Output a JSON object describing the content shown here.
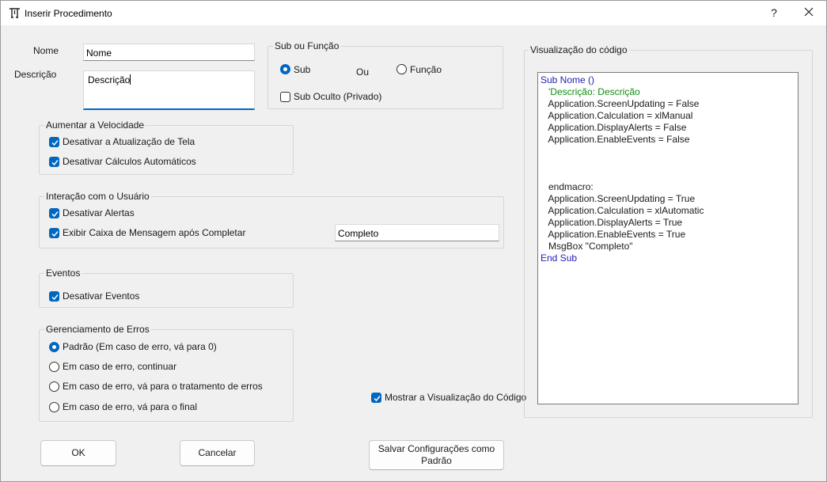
{
  "window": {
    "title": "Inserir Procedimento",
    "help_label": "?"
  },
  "form": {
    "name_label": "Nome",
    "name_value": "Nome",
    "description_label": "Descrição",
    "description_value": "Descrição"
  },
  "sub_function": {
    "legend": "Sub ou Função",
    "sub_label": "Sub",
    "or_label": "Ou",
    "function_label": "Função",
    "selected": "Sub",
    "hidden_label": "Sub Oculto (Privado)",
    "hidden_checked": false
  },
  "speed": {
    "legend": "Aumentar a Velocidade",
    "items": [
      {
        "label": "Desativar a Atualização de Tela",
        "checked": true
      },
      {
        "label": "Desativar Cálculos Automáticos",
        "checked": true
      }
    ]
  },
  "user_interaction": {
    "legend": "Interação com o Usuário",
    "items": [
      {
        "label": "Desativar Alertas",
        "checked": true
      },
      {
        "label": "Exibir Caixa de Mensagem após Completar",
        "checked": true
      }
    ],
    "message_value": "Completo"
  },
  "events": {
    "legend": "Eventos",
    "items": [
      {
        "label": "Desativar Eventos",
        "checked": true
      }
    ]
  },
  "error_handling": {
    "legend": "Gerenciamento de Erros",
    "options": [
      {
        "label": "Padrão (Em caso de erro, vá para 0)",
        "selected": true
      },
      {
        "label": "Em caso de erro, continuar",
        "selected": false
      },
      {
        "label": "Em caso de erro, vá para o tratamento de erros",
        "selected": false
      },
      {
        "label": "Em caso de erro, vá para o final",
        "selected": false
      }
    ]
  },
  "preview": {
    "legend": "Visualização do código",
    "show_label": "Mostrar a Visualização do Código",
    "show_checked": true,
    "lines": [
      {
        "text": "Sub Nome ()",
        "kind": "keyword"
      },
      {
        "text": "   'Descrição: Descrição",
        "kind": "comment"
      },
      {
        "text": "   Application.ScreenUpdating = False",
        "kind": "normal"
      },
      {
        "text": "   Application.Calculation = xlManual",
        "kind": "normal"
      },
      {
        "text": "   Application.DisplayAlerts = False",
        "kind": "normal"
      },
      {
        "text": "   Application.EnableEvents = False",
        "kind": "normal"
      },
      {
        "text": "",
        "kind": "normal"
      },
      {
        "text": "",
        "kind": "normal"
      },
      {
        "text": "",
        "kind": "normal"
      },
      {
        "text": "   endmacro:",
        "kind": "normal"
      },
      {
        "text": "   Application.ScreenUpdating = True",
        "kind": "normal"
      },
      {
        "text": "   Application.Calculation = xlAutomatic",
        "kind": "normal"
      },
      {
        "text": "   Application.DisplayAlerts = True",
        "kind": "normal"
      },
      {
        "text": "   Application.EnableEvents = True",
        "kind": "normal"
      },
      {
        "text": "   MsgBox \"Completo\"",
        "kind": "normal"
      },
      {
        "text": "End Sub",
        "kind": "keyword"
      }
    ]
  },
  "buttons": {
    "ok": "OK",
    "cancel": "Cancelar",
    "save_defaults": "Salvar Configurações como Padrão"
  },
  "colors": {
    "accent": "#0067c0",
    "keyword": "#1f1fb8",
    "comment": "#128a12"
  }
}
